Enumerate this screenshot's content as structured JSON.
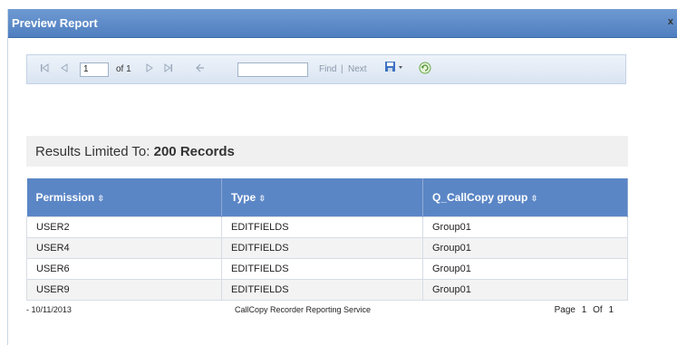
{
  "window": {
    "title": "Preview Report",
    "close_glyph": "x"
  },
  "toolbar": {
    "first_icon": "first-page-icon",
    "prev_icon": "previous-page-icon",
    "page_value": "1",
    "of_label": "of 1",
    "next_icon": "next-page-icon",
    "last_icon": "last-page-icon",
    "back_icon": "back-icon",
    "find_value": "",
    "find_label": "Find",
    "separator": "|",
    "next_label": "Next",
    "export_icon": "save-export-icon",
    "refresh_icon": "refresh-icon"
  },
  "results": {
    "prefix": "Results Limited To:",
    "count": "200 Records"
  },
  "table": {
    "columns": [
      "Permission",
      "Type",
      "Q_CallCopy group"
    ],
    "rows": [
      [
        "USER2",
        "EDITFIELDS",
        "Group01"
      ],
      [
        "USER4",
        "EDITFIELDS",
        "Group01"
      ],
      [
        "USER6",
        "EDITFIELDS",
        "Group01"
      ],
      [
        "USER9",
        "EDITFIELDS",
        "Group01"
      ]
    ]
  },
  "footer": {
    "date": "- 10/11/2013",
    "service": "CallCopy Recorder Reporting Service",
    "page_label": "Page",
    "page_num": "1",
    "of_label": "Of",
    "page_total": "1"
  },
  "colors": {
    "titlebar": "#5b86c6",
    "header": "#5b86c6",
    "toolbar": "#dfe8f3"
  }
}
